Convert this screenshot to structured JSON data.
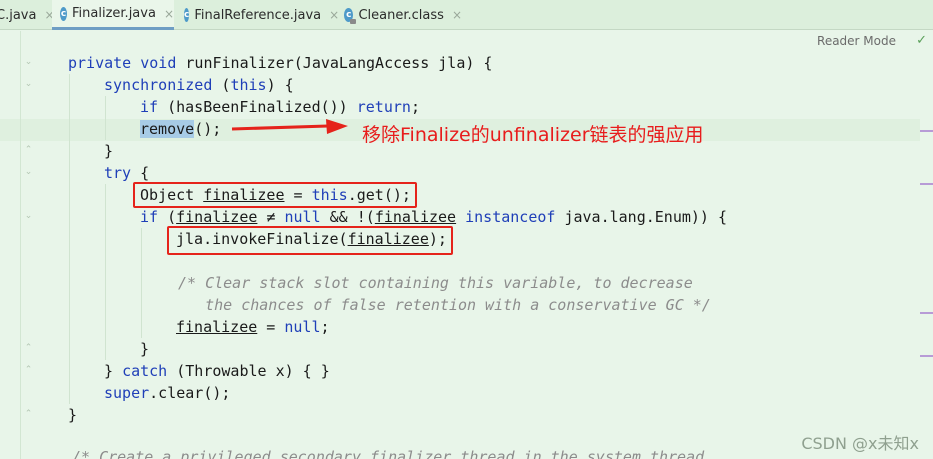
{
  "tabs": [
    {
      "label": "C.java",
      "active": false,
      "icon": "none"
    },
    {
      "label": "Finalizer.java",
      "active": true,
      "icon": "class-icon"
    },
    {
      "label": "FinalReference.java",
      "active": false,
      "icon": "class-icon"
    },
    {
      "label": "Cleaner.class",
      "active": false,
      "icon": "class-icon"
    }
  ],
  "close_glyph": "×",
  "reader_mode": "Reader Mode",
  "code": {
    "l1_kw": "private void",
    "l1_rest": " runFinalizer(JavaLangAccess jla) {",
    "l2_kw": "synchronized",
    "l2_mid": " (",
    "l2_this": "this",
    "l2_end": ") {",
    "l3_if": "if",
    "l3_mid": " (hasBeenFinalized()) ",
    "l3_ret": "return",
    "l3_end": ";",
    "l4_sel": "remove",
    "l4_end": "();",
    "l5": "}",
    "l6_try": "try",
    "l6_end": " {",
    "l7_a": "Object ",
    "l7_var": "finalizee",
    "l7_b": " = ",
    "l7_this": "this",
    "l7_c": ".get();",
    "l8_if": "if",
    "l8_a": " (",
    "l8_var": "finalizee",
    "l8_b": " ≠ ",
    "l8_null": "null",
    "l8_c": " && !(",
    "l8_var2": "finalizee",
    "l8_d": " ",
    "l8_inst": "instanceof",
    "l8_e": " java.lang.Enum)) {",
    "l9_a": "jla.invokeFinalize(",
    "l9_var": "finalizee",
    "l9_b": ");",
    "l10": "/* Clear stack slot containing this variable, to decrease",
    "l11": "   the chances of false retention with a conservative GC */",
    "l12_var": "finalizee",
    "l12_a": " = ",
    "l12_null": "null",
    "l12_b": ";",
    "l13": "}",
    "l14_a": "} ",
    "l14_catch": "catch",
    "l14_b": " (Throwable x) { }",
    "l15_super": "super",
    "l15_a": ".clear();",
    "l16": "}",
    "l17": "/* Create a privileged secondary finalizer thread in the system thread"
  },
  "annotation": "移除Finalize的unfinalizer链表的强应用",
  "watermark": "CSDN @x未知x",
  "colors": {
    "background": "#e8f5e9",
    "keyword": "#1f3fb8",
    "comment": "#8c8c8c",
    "highlight_box": "#e5231b",
    "annotation": "#e81c1c"
  }
}
